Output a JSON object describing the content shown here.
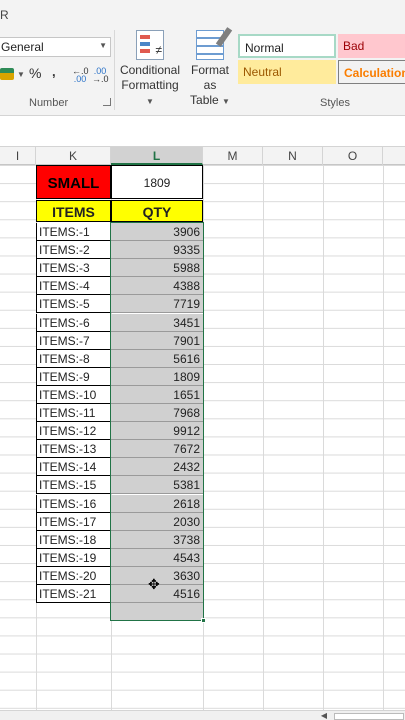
{
  "title_fragment": "R",
  "ribbon": {
    "number_format": "General",
    "percent_symbol": "%",
    "comma_symbol": ",",
    "increase_decimal": {
      "top": "←.0",
      "bottom": ".00"
    },
    "decrease_decimal": {
      "top": ".00",
      "bottom": "→.0"
    },
    "number_group_label": "Number",
    "conditional_formatting": {
      "line1": "Conditional",
      "line2": "Formatting"
    },
    "format_as_table": {
      "line1": "Format as",
      "line2": "Table"
    },
    "styles": {
      "normal": "Normal",
      "bad": "Bad",
      "neutral": "Neutral",
      "calculation": "Calculation"
    },
    "styles_group_label": "Styles"
  },
  "columns": [
    "I",
    "K",
    "L",
    "M",
    "N",
    "O"
  ],
  "selected_column": "L",
  "sheet": {
    "small_label": "SMALL",
    "small_value": "1809",
    "items_header": "ITEMS",
    "qty_header": "QTY",
    "rows": [
      {
        "item": "ITEMS:-1",
        "qty": "3906"
      },
      {
        "item": "ITEMS:-2",
        "qty": "9335"
      },
      {
        "item": "ITEMS:-3",
        "qty": "5988"
      },
      {
        "item": "ITEMS:-4",
        "qty": "4388"
      },
      {
        "item": "ITEMS:-5",
        "qty": "7719"
      },
      {
        "item": "ITEMS:-6",
        "qty": "3451"
      },
      {
        "item": "ITEMS:-7",
        "qty": "7901"
      },
      {
        "item": "ITEMS:-8",
        "qty": "5616"
      },
      {
        "item": "ITEMS:-9",
        "qty": "1809"
      },
      {
        "item": "ITEMS:-10",
        "qty": "1651"
      },
      {
        "item": "ITEMS:-11",
        "qty": "7968"
      },
      {
        "item": "ITEMS:-12",
        "qty": "9912"
      },
      {
        "item": "ITEMS:-13",
        "qty": "7672"
      },
      {
        "item": "ITEMS:-14",
        "qty": "2432"
      },
      {
        "item": "ITEMS:-15",
        "qty": "5381"
      },
      {
        "item": "ITEMS:-16",
        "qty": "2618"
      },
      {
        "item": "ITEMS:-17",
        "qty": "2030"
      },
      {
        "item": "ITEMS:-18",
        "qty": "3738"
      },
      {
        "item": "ITEMS:-19",
        "qty": "4543"
      },
      {
        "item": "ITEMS:-20",
        "qty": "3630"
      },
      {
        "item": "ITEMS:-21",
        "qty": "4516"
      }
    ]
  },
  "colors": {
    "small_fill": "#ff0000",
    "header_fill": "#ffff00",
    "selection_fill": "#d0d0d0",
    "excel_green": "#217346"
  }
}
